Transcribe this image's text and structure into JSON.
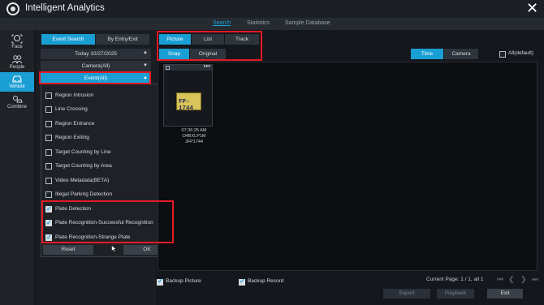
{
  "app": {
    "title": "Intelligent Analytics"
  },
  "nav": {
    "tabs": [
      "Search",
      "Statistics",
      "Sample Database"
    ]
  },
  "sidebar": {
    "items": [
      "Face",
      "People",
      "Vehicle",
      "Combine"
    ]
  },
  "left": {
    "mode_tabs": [
      "Event Search",
      "By Entry/Exit"
    ],
    "date_select": "Today 10/27/2025",
    "camera_select": "Camera(All)",
    "event_select": "Event(All)"
  },
  "dropdown": {
    "items": [
      {
        "label": "Region Intrusion",
        "checked": false
      },
      {
        "label": "Line Crossing",
        "checked": false
      },
      {
        "label": "Region Entrance",
        "checked": false
      },
      {
        "label": "Region Exiting",
        "checked": false
      },
      {
        "label": "Target Counting by Line",
        "checked": false
      },
      {
        "label": "Target Counting by Area",
        "checked": false
      },
      {
        "label": "Video Metadata(BETA)",
        "checked": false
      },
      {
        "label": "Illegal Parking Detection",
        "checked": false
      },
      {
        "label": "Plate Detection",
        "checked": true
      },
      {
        "label": "Plate Recognition-Successful Recognition",
        "checked": true
      },
      {
        "label": "Plate Recognition-Strange Plate",
        "checked": true
      }
    ],
    "reset_label": "Reset",
    "ok_label": "OK"
  },
  "view": {
    "view_tabs": [
      "Picture",
      "List",
      "Track"
    ],
    "image_tabs": [
      "Snap",
      "Original"
    ],
    "sort_tabs": [
      "Time",
      "Camera"
    ],
    "all_default_label": "All(default)"
  },
  "result": {
    "plate_text": "FP-1744",
    "time": "07:36:25 AM",
    "camera": "O4BXLP1M",
    "plate": "JFP1744"
  },
  "bottom": {
    "backup_picture_label": "Backup Picture",
    "backup_record_label": "Backup Record",
    "page_info": "Current Page: 1 / 1, all 1",
    "export_label": "Export",
    "playback_label": "Playback",
    "exit_label": "Exit"
  },
  "colors": {
    "accent": "#1a9fd4",
    "highlight_box": "#e51b24"
  }
}
